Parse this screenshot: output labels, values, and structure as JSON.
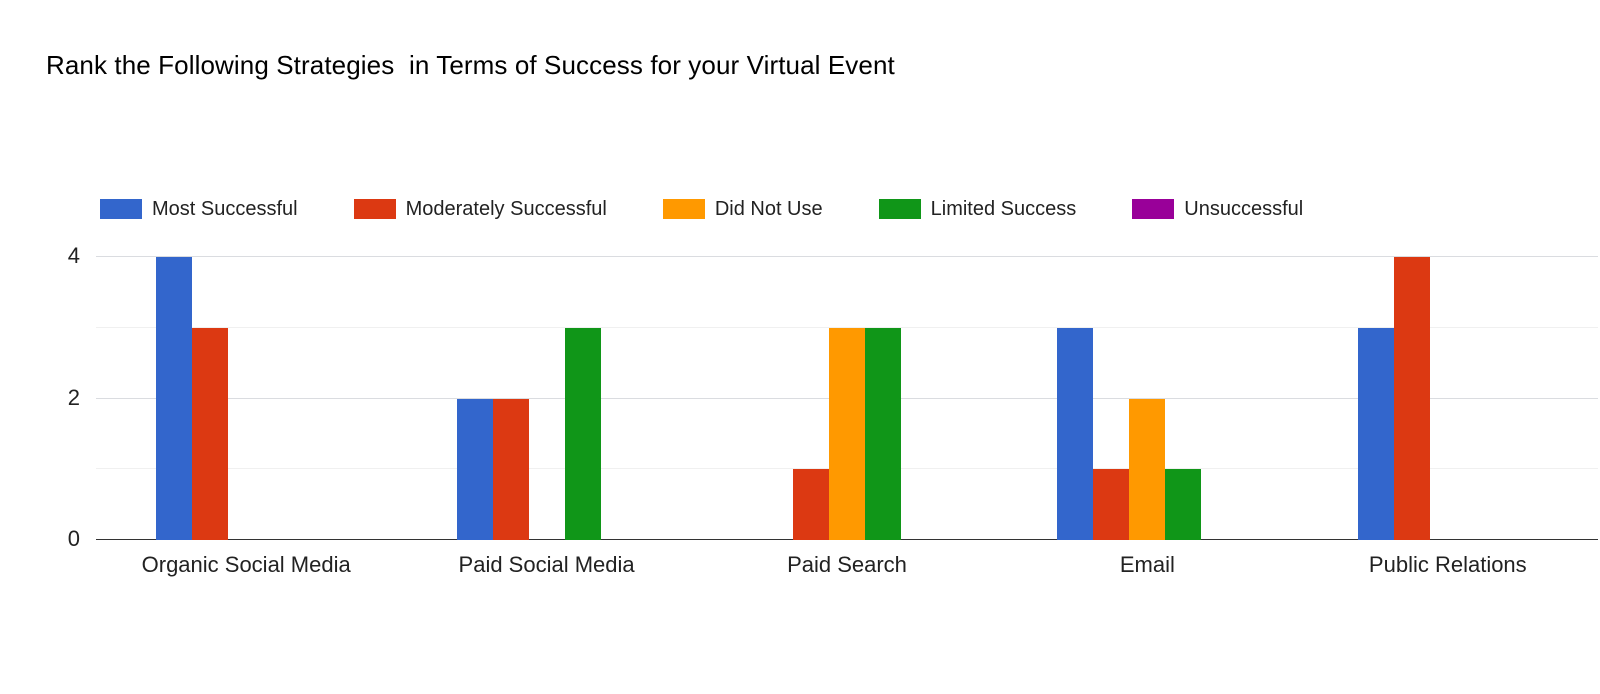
{
  "chart_data": {
    "type": "bar",
    "title": "Rank the Following Strategies  in Terms of Success for your Virtual Event",
    "subtitle": "",
    "xlabel": "",
    "ylabel": "",
    "ylim": [
      0,
      4
    ],
    "yticks": [
      "0",
      "2",
      "4"
    ],
    "ytick_values": [
      0,
      2,
      4
    ],
    "minor_gridlines": [
      1,
      3
    ],
    "grid": true,
    "legend_position": "top-left",
    "categories": [
      "Organic Social Media",
      "Paid Social Media",
      "Paid Search",
      "Email",
      "Public Relations"
    ],
    "series": [
      {
        "name": "Most Successful",
        "color": "#3366cc",
        "values": [
          4,
          2,
          0,
          3,
          3
        ]
      },
      {
        "name": "Moderately Successful",
        "color": "#dc3912",
        "values": [
          3,
          2,
          1,
          1,
          4
        ]
      },
      {
        "name": "Did Not Use",
        "color": "#ff9900",
        "values": [
          0,
          0,
          3,
          2,
          0
        ]
      },
      {
        "name": "Limited Success",
        "color": "#109618",
        "values": [
          0,
          3,
          3,
          1,
          0
        ]
      },
      {
        "name": "Unsuccessful",
        "color": "#990099",
        "values": [
          0,
          0,
          0,
          0,
          0
        ]
      }
    ]
  },
  "colors": {
    "background": "#ffffff",
    "text": "#222222",
    "title": "#000000",
    "gridline_major": "#dadce0",
    "gridline_minor": "#f0f0f0",
    "axis": "#333333"
  }
}
